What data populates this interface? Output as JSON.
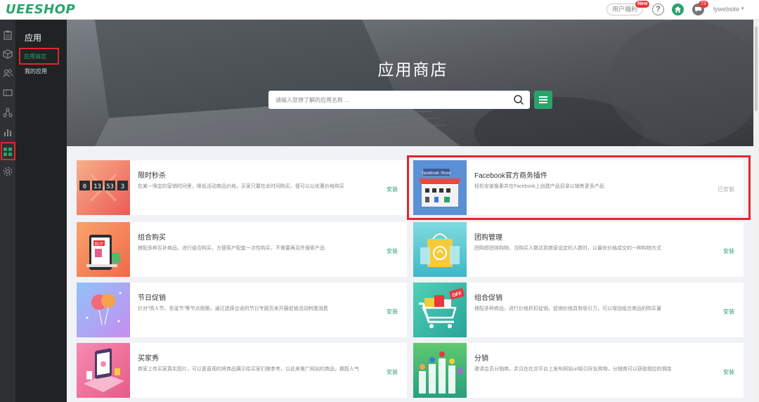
{
  "brand": {
    "logo": "UEESHOP",
    "accent": "#2aa36b",
    "highlight": "#e4262d"
  },
  "header": {
    "feedback_label": "用户福利",
    "feedback_badge": "New",
    "help_label": "?",
    "message_count": "73",
    "user_name": "lywebsite",
    "caret": "▾"
  },
  "rail": {
    "icons": [
      "clipboard-icon",
      "cube-icon",
      "users-icon",
      "ticket-icon",
      "nodes-icon",
      "bar-chart-icon",
      "apps-grid-icon",
      "gear-icon"
    ],
    "active": "apps-grid-icon"
  },
  "subnav": {
    "title": "应用",
    "items": [
      {
        "label": "应用商店",
        "active": true
      },
      {
        "label": "我的应用",
        "active": false
      }
    ]
  },
  "hero": {
    "title": "应用商店",
    "search_placeholder": "请输入您想了解的应用名称 ..."
  },
  "apps": [
    {
      "title": "限时秒杀",
      "desc": "在某一限定的营销时间里，降低活动商品价格，买家只要在此时间购买，便可以以优惠价格购买",
      "action": "安装",
      "installed": false,
      "thumb_text": [
        "02",
        "13",
        "53"
      ]
    },
    {
      "title": "Facebook官方商务插件",
      "desc": "轻松安装像素并在Facebook上创建产品目录以销售更多产品",
      "action": "已安装",
      "installed": true,
      "thumb_text": [
        "facebook Store"
      ]
    },
    {
      "title": "组合购买",
      "desc": "搭配多种互补商品，进行组合购买，方便客户配套一次性购买，不需要再另外搜索产品",
      "action": "安装",
      "installed": false,
      "thumb_text": [
        "BUY"
      ]
    },
    {
      "title": "团购管理",
      "desc": "团购即团体购物，当购买人数达到商家设定的人数时，以最优价格成交的一种购物方式",
      "action": "安装",
      "installed": false,
      "thumb_text": []
    },
    {
      "title": "节日促销",
      "desc": "针对“情人节、圣诞节”等节点假期，通过选择合适的节日专题页来开展促销活动刺激消费",
      "action": "安装",
      "installed": false,
      "thumb_text": []
    },
    {
      "title": "组合促销",
      "desc": "搭配多种商品，进行价格折扣促销，促销价格具有吸引力，可以增加组合商品的购买量",
      "action": "安装",
      "installed": false,
      "thumb_text": [
        "OFF"
      ]
    },
    {
      "title": "买家秀",
      "desc": "商家上传买家真实图片，可以更直观的将商品展示给买家们做参考，以此来推广网站的商品，拥揽人气",
      "action": "安装",
      "installed": false,
      "thumb_text": []
    },
    {
      "title": "分销",
      "desc": "邀请会员分销商，并且在社交平台上发布网站url吸引好友购物，分销商可以获取相应的佣金",
      "action": "安装",
      "installed": false,
      "thumb_text": []
    }
  ]
}
